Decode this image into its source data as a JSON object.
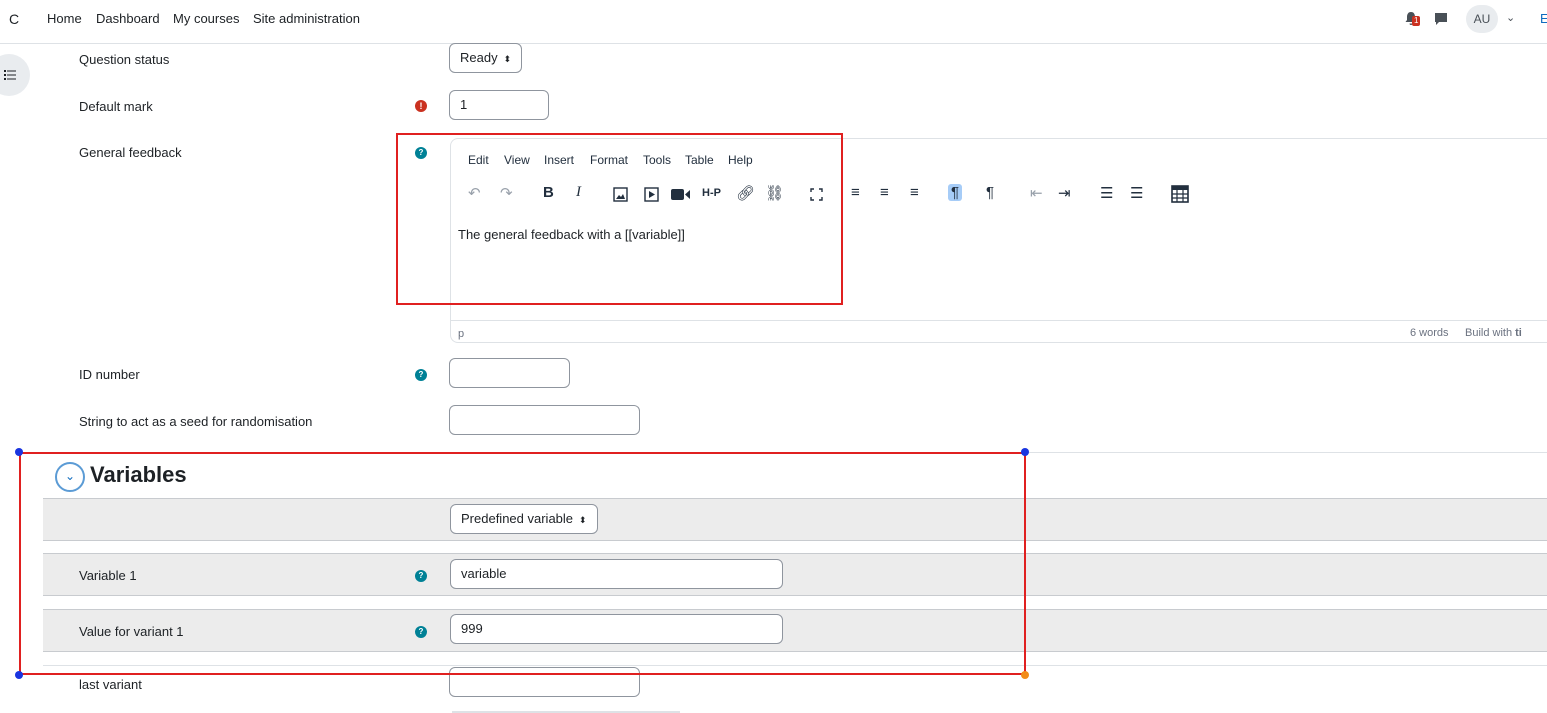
{
  "navbar": {
    "brand": "C",
    "links": [
      "Home",
      "Dashboard",
      "My courses",
      "Site administration"
    ],
    "notification_count": "1",
    "avatar_initials": "AU",
    "user_menu_caret": "⌄",
    "edit_mode_partial": "E"
  },
  "form": {
    "question_status": {
      "label": "Question status",
      "value": "Ready"
    },
    "default_mark": {
      "label": "Default mark",
      "value": "1"
    },
    "general_feedback": {
      "label": "General feedback",
      "menu": [
        "Edit",
        "View",
        "Insert",
        "Format",
        "Tools",
        "Table",
        "Help"
      ],
      "content": "The general feedback with a [[variable]]",
      "status_path": "p",
      "word_count": "6 words",
      "build_with": "Build with",
      "brand_partial": "ti"
    },
    "id_number": {
      "label": "ID number",
      "value": ""
    },
    "seed": {
      "label": "String to act as a seed for randomisation",
      "value": ""
    }
  },
  "variables_section": {
    "title": "Variables",
    "predefined_select": "Predefined variable",
    "rows": [
      {
        "label": "Variable 1",
        "value": "variable"
      },
      {
        "label": "Value for variant 1",
        "value": "999"
      }
    ],
    "last_variant": {
      "label": "last variant",
      "value": ""
    }
  },
  "colors": {
    "annotation_red": "#e02020",
    "handle_blue": "#1a35e0",
    "handle_orange": "#f28c1a",
    "help_teal": "#008196",
    "error_red": "#ca3120"
  },
  "icons": {
    "toolbar": [
      "undo-icon",
      "redo-icon",
      "bold-icon",
      "italic-icon",
      "image-icon",
      "media-icon",
      "video-icon",
      "h5p-icon",
      "link-icon",
      "unlink-icon",
      "fullscreen-icon",
      "align-left-icon",
      "align-center-icon",
      "align-right-icon",
      "ltr-icon",
      "rtl-icon",
      "outdent-icon",
      "indent-icon",
      "bullet-list-icon",
      "numbered-list-icon",
      "calculator-icon"
    ]
  }
}
